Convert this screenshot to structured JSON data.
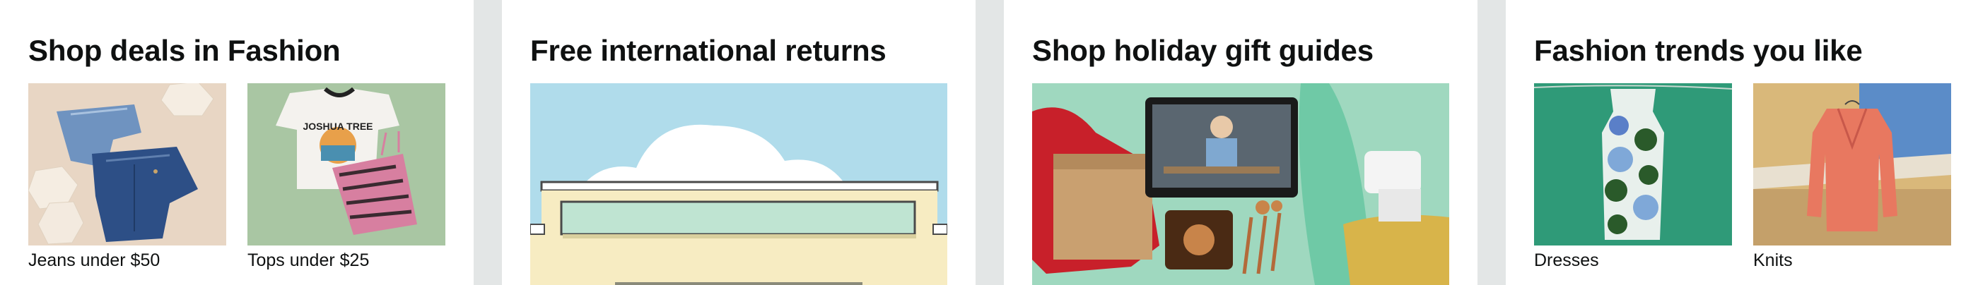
{
  "cards": [
    {
      "title": "Shop deals in Fashion",
      "items": [
        {
          "label": "Jeans under $50"
        },
        {
          "label": "Tops under $25"
        }
      ]
    },
    {
      "title": "Free international returns"
    },
    {
      "title": "Shop holiday gift guides"
    },
    {
      "title": "Fashion trends you like",
      "items": [
        {
          "label": "Dresses"
        },
        {
          "label": "Knits"
        }
      ]
    }
  ],
  "images": {
    "tshirt_print": "JOSHUA TREE"
  },
  "colors": {
    "page_background": "#e3e6e6",
    "card_background": "#ffffff",
    "text": "#0f1111"
  }
}
